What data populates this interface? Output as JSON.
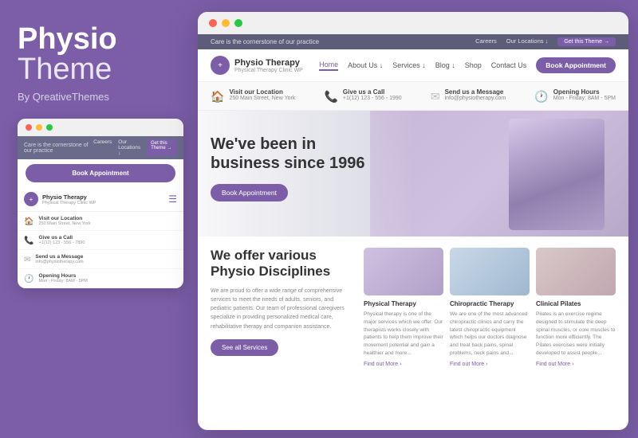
{
  "left": {
    "brand_bold": "Physio",
    "brand_light": "Theme",
    "brand_by": "By QreativeThemes"
  },
  "mini": {
    "browser_dots": [
      "red",
      "yellow",
      "green"
    ],
    "top_bar_text": "Care is the cornerstone of our practice",
    "top_links": [
      "Careers",
      "Our Locations ↓",
      "Get this Theme →"
    ],
    "book_btn": "Book Appointment",
    "logo_name": "Physio Therapy",
    "logo_sub": "Physical Therapy Clinic WP",
    "info_rows": [
      {
        "icon": "🏠",
        "title": "Visit our Location",
        "sub": "250 Main Street, New York"
      },
      {
        "icon": "📞",
        "title": "Give us a Call",
        "sub": "+1(12) 123 - 556 - 7890"
      },
      {
        "icon": "✉",
        "title": "Send us a Message",
        "sub": "info@physiotherapy.com"
      },
      {
        "icon": "🕐",
        "title": "Opening Hours",
        "sub": "Mon - Friday: 8AM - 5PM"
      }
    ]
  },
  "site": {
    "top_bar_text": "Care is the cornerstone of our practice",
    "top_links": [
      "Careers",
      "Our Locations ↓",
      "Get this Theme →"
    ],
    "logo_name": "Physio Therapy",
    "logo_sub": "Physical Therapy Clinic WP",
    "nav_links": [
      "Home",
      "About Us ↓",
      "Services ↓",
      "Blog ↓",
      "Shop",
      "Contact Us"
    ],
    "nav_book": "Book Appointment",
    "info_items": [
      {
        "icon": "🏠",
        "title": "Visit our Location",
        "val": "250 Main Street, New York"
      },
      {
        "icon": "📞",
        "title": "Give us a Call",
        "val": "+1(12) 123 - 556 - 1990"
      },
      {
        "icon": "✉",
        "title": "Send us a Message",
        "val": "info@physiotherapy.com"
      },
      {
        "icon": "🕐",
        "title": "Opening Hours",
        "val": "Mon - Friday: 8AM - 5PM"
      }
    ],
    "hero_title": "We've been in business since 1996",
    "hero_book": "Book Appointment",
    "offer_title": "We offer various Physio Disciplines",
    "offer_text": "We are proud to offer a wide range of comprehensive services to meet the needs of adults, seniors, and pediatric patients. Our team of professional caregivers specialize in providing personalized medical care, rehabilitative therapy and companion assistance.",
    "see_all": "See all Services",
    "cards": [
      {
        "title": "Physical Therapy",
        "text": "Physical therapy is one of the major services which we offer. Our therapists works closely with patients to help them improve their movement potential and gain a healthier and more...",
        "link": "Find out More ›"
      },
      {
        "title": "Chiropractic Therapy",
        "text": "We are one of the most advanced chiropractic clinics and carry the latest chiropractic equipment which helps our doctors diagnose and treat back pains, spinal problems, neck pains and...",
        "link": "Find out More ›"
      },
      {
        "title": "Clinical Pilates",
        "text": "Pilates is an exercise regime designed to stimulate the deep spinal muscles, or core muscles to function more efficiently. The Pilates exercises were initially developed to assist people...",
        "link": "Find out More ›"
      }
    ]
  }
}
